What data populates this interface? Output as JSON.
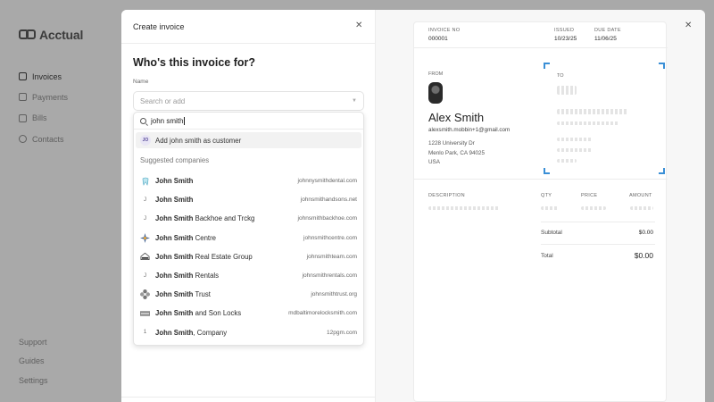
{
  "app": {
    "logo_text": "Acctual",
    "nav": [
      {
        "label": "Invoices",
        "icon": "file-icon",
        "active": true
      },
      {
        "label": "Payments",
        "icon": "payments-icon",
        "active": false
      },
      {
        "label": "Bills",
        "icon": "bill-icon",
        "active": false
      },
      {
        "label": "Contacts",
        "icon": "contacts-icon",
        "active": false
      }
    ],
    "bottom_nav": [
      "Support",
      "Guides",
      "Settings"
    ]
  },
  "modal": {
    "title": "Create invoice",
    "question": "Who's this invoice for?",
    "name_label": "Name",
    "select_placeholder": "Search or add",
    "search_query": "john smith",
    "add_avatar": "JO",
    "add_label": "Add john smith as customer",
    "suggested_label": "Suggested companies",
    "companies": [
      {
        "bold": "John Smith",
        "rest": "",
        "url": "johnnysmithdental.com",
        "logo": "tooth-logo-icon"
      },
      {
        "bold": "John Smith",
        "rest": "",
        "url": "johnsmithandsons.net",
        "logo": "letter-j-icon"
      },
      {
        "bold": "John Smith",
        "rest": " Backhoe and Trckg",
        "url": "johnsmithbackhoe.com",
        "logo": "letter-j-icon"
      },
      {
        "bold": "John Smith",
        "rest": " Centre",
        "url": "johnsmithcentre.com",
        "logo": "star-logo-icon"
      },
      {
        "bold": "John Smith",
        "rest": " Real Estate Group",
        "url": "johnsmithteam.com",
        "logo": "house-logo-icon"
      },
      {
        "bold": "John Smith",
        "rest": " Rentals",
        "url": "johnsmithrentals.com",
        "logo": "letter-j-icon"
      },
      {
        "bold": "John Smith",
        "rest": " Trust",
        "url": "johnsmithtrust.org",
        "logo": "cross-logo-icon"
      },
      {
        "bold": "John Smith",
        "rest": " and Son Locks",
        "url": "mdbaltimorelocksmith.com",
        "logo": "lock-logo-icon"
      },
      {
        "bold": "John Smith",
        "rest": ", Company",
        "url": "12pgm.com",
        "logo": "number-1-icon"
      }
    ]
  },
  "invoice": {
    "no_label": "INVOICE NO",
    "no_value": "000001",
    "issued_label": "ISSUED",
    "issued_value": "10/23/25",
    "due_label": "DUE DATE",
    "due_value": "11/06/25",
    "from_label": "FROM",
    "from_name": "Alex Smith",
    "from_email": "alexsmith.mobbin+1@gmail.com",
    "from_address_1": "1228 University Dr",
    "from_address_2": "Menlo Park, CA 94025",
    "from_address_3": "USA",
    "to_label": "TO",
    "col_description": "DESCRIPTION",
    "col_qty": "QTY",
    "col_price": "PRICE",
    "col_amount": "AMOUNT",
    "subtotal_label": "Subtotal",
    "subtotal_value": "$0.00",
    "total_label": "Total",
    "total_value": "$0.00",
    "accent_color": "#3a8fd6"
  }
}
